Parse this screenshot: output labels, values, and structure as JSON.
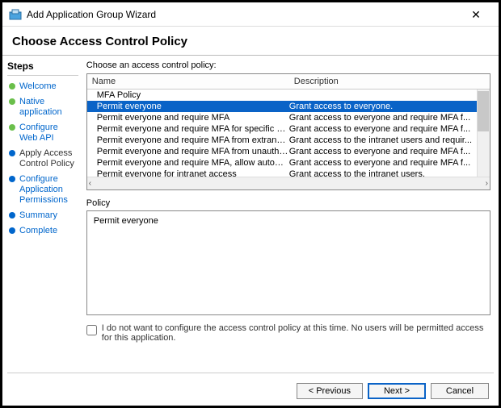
{
  "window": {
    "title": "Add Application Group Wizard"
  },
  "subtitle": "Choose Access Control Policy",
  "sidebar": {
    "heading": "Steps",
    "items": [
      {
        "label": "Welcome",
        "state": "done"
      },
      {
        "label": "Native application",
        "state": "done"
      },
      {
        "label": "Configure Web API",
        "state": "done"
      },
      {
        "label": "Apply Access Control Policy",
        "state": "current"
      },
      {
        "label": "Configure Application Permissions",
        "state": "todo"
      },
      {
        "label": "Summary",
        "state": "todo"
      },
      {
        "label": "Complete",
        "state": "todo"
      }
    ]
  },
  "content": {
    "prompt": "Choose an access control policy:",
    "columns": {
      "name": "Name",
      "description": "Description"
    },
    "rows": [
      {
        "name": "MFA Policy",
        "desc": "",
        "selected": false
      },
      {
        "name": "Permit everyone",
        "desc": "Grant access to everyone.",
        "selected": true
      },
      {
        "name": "Permit everyone and require MFA",
        "desc": "Grant access to everyone and require MFA f...",
        "selected": false
      },
      {
        "name": "Permit everyone and require MFA for specific group",
        "desc": "Grant access to everyone and require MFA f...",
        "selected": false
      },
      {
        "name": "Permit everyone and require MFA from extranet access",
        "desc": "Grant access to the intranet users and requir...",
        "selected": false
      },
      {
        "name": "Permit everyone and require MFA from unauthenticated ...",
        "desc": "Grant access to everyone and require MFA f...",
        "selected": false
      },
      {
        "name": "Permit everyone and require MFA, allow automatic devi...",
        "desc": "Grant access to everyone and require MFA f...",
        "selected": false
      },
      {
        "name": "Permit everyone for intranet access",
        "desc": "Grant access to the intranet users.",
        "selected": false
      }
    ],
    "policy_label": "Policy",
    "policy_text": "Permit everyone",
    "consent_text": "I do not want to configure the access control policy at this time.  No users will be permitted access for this application."
  },
  "footer": {
    "previous": "< Previous",
    "next": "Next >",
    "cancel": "Cancel"
  }
}
